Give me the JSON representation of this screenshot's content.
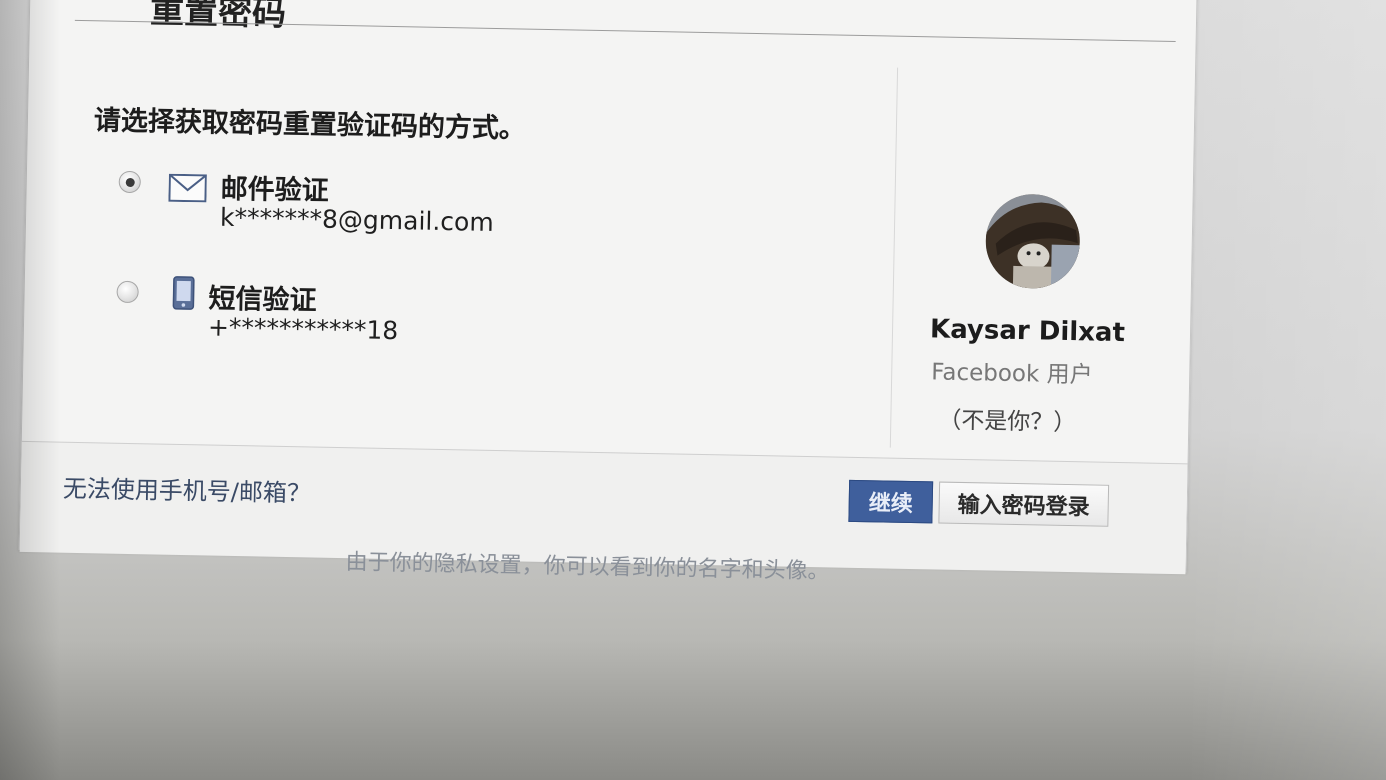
{
  "header": {
    "title": "重置密码"
  },
  "prompt": "请选择获取密码重置验证码的方式。",
  "options": [
    {
      "label": "邮件验证",
      "detail": "k*******8@gmail.com",
      "selected": true,
      "icon": "envelope-icon"
    },
    {
      "label": "短信验证",
      "detail": "+***********18",
      "selected": false,
      "icon": "mobile-phone-icon"
    }
  ],
  "profile": {
    "name": "Kaysar Dilxat",
    "subtitle": "Facebook 用户",
    "not_you": "（不是你？）"
  },
  "footer": {
    "cant_use": "无法使用手机号/邮箱？",
    "continue_label": "继续",
    "password_login_label": "输入密码登录"
  },
  "privacy_note": "由于你的隐私设置，你可以看到你的名字和头像。",
  "colors": {
    "primary_button": "#3f5f9c",
    "link": "#3a4a66"
  }
}
